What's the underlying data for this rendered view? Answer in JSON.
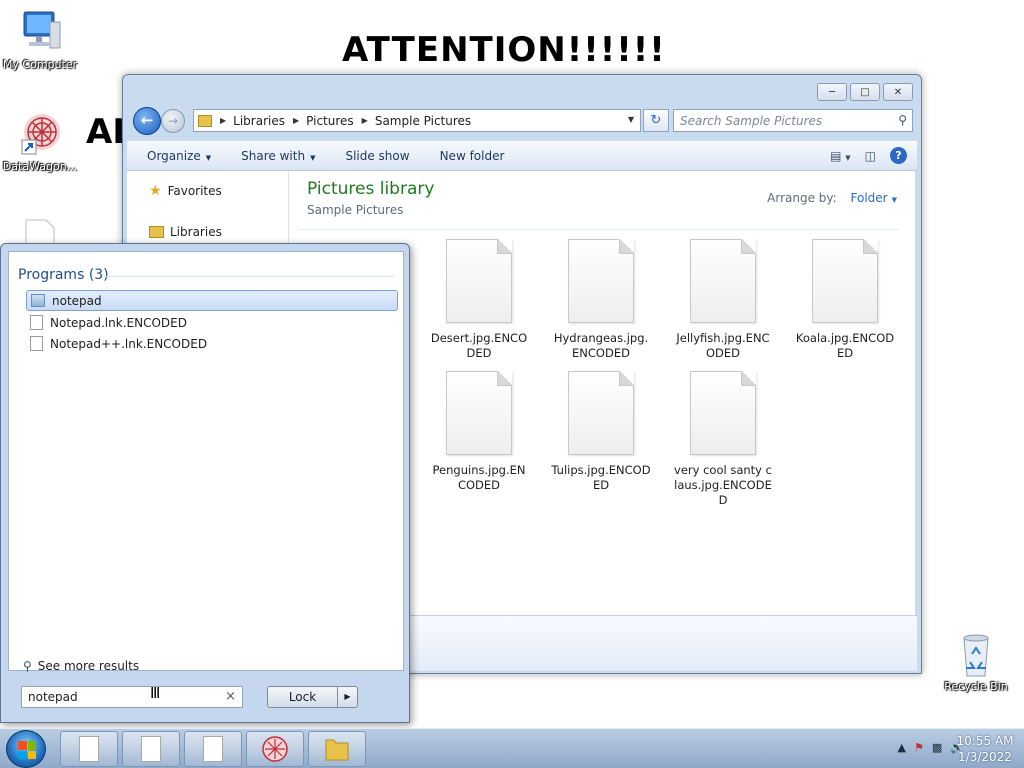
{
  "desktop": {
    "ransom_title": "ATTENTION!!!!!!",
    "ransom_fragment_1": "AL",
    "ransom_fragment_2": "",
    "icons": [
      {
        "label": "My Computer",
        "icon": "computer-icon"
      },
      {
        "label": "DataWagon...",
        "icon": "datawagon-icon"
      },
      {
        "label": "Recycle Bin",
        "icon": "recycle-bin-icon"
      }
    ]
  },
  "explorer": {
    "breadcrumb": [
      "Libraries",
      "Pictures",
      "Sample Pictures"
    ],
    "search_placeholder": "Search Sample Pictures",
    "toolbar": {
      "organize": "Organize",
      "share_with": "Share with",
      "slide_show": "Slide show",
      "new_folder": "New folder"
    },
    "nav": {
      "favorites": "Favorites",
      "libraries": "Libraries"
    },
    "library_title": "Pictures library",
    "library_subtitle": "Sample Pictures",
    "arrange_label": "Arrange by:",
    "arrange_value": "Folder",
    "files": [
      {
        "name": "Desert.jpg.ENCODED"
      },
      {
        "name": "Hydrangeas.jpg.ENCODED"
      },
      {
        "name": "Jellyfish.jpg.ENCODED"
      },
      {
        "name": "Koala.jpg.ENCODED"
      },
      {
        "name": "Penguins.jpg.ENCODED"
      },
      {
        "name": "Tulips.jpg.ENCODED"
      },
      {
        "name": "very cool santy claus.jpg.ENCODED"
      }
    ]
  },
  "start_menu": {
    "section_title": "Programs (3)",
    "items": [
      {
        "label": "notepad",
        "selected": true
      },
      {
        "label": "Notepad.lnk.ENCODED",
        "selected": false
      },
      {
        "label": "Notepad++.lnk.ENCODED",
        "selected": false
      }
    ],
    "see_more": "See more results",
    "search_value": "notepad",
    "lock_label": "Lock"
  },
  "taskbar": {
    "time": "10:55 AM",
    "date": "1/3/2022"
  },
  "colors": {
    "library_title": "#1e7a1e",
    "accent_blue": "#2e6cc1"
  }
}
